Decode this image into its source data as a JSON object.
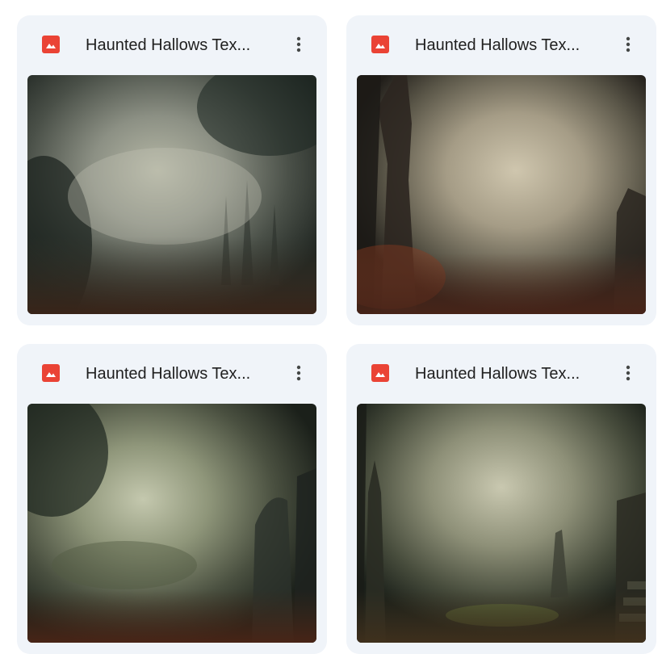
{
  "files": [
    {
      "name": "Haunted Hallows Tex...",
      "file_type_icon": "image-file-icon",
      "menu_icon": "more-vert-icon"
    },
    {
      "name": "Haunted Hallows Tex...",
      "file_type_icon": "image-file-icon",
      "menu_icon": "more-vert-icon"
    },
    {
      "name": "Haunted Hallows Tex...",
      "file_type_icon": "image-file-icon",
      "menu_icon": "more-vert-icon"
    },
    {
      "name": "Haunted Hallows Tex...",
      "file_type_icon": "image-file-icon",
      "menu_icon": "more-vert-icon"
    }
  ],
  "colors": {
    "card_background": "#f0f4f9",
    "file_icon": "#ea4335",
    "title_text": "#1f1f1f"
  }
}
